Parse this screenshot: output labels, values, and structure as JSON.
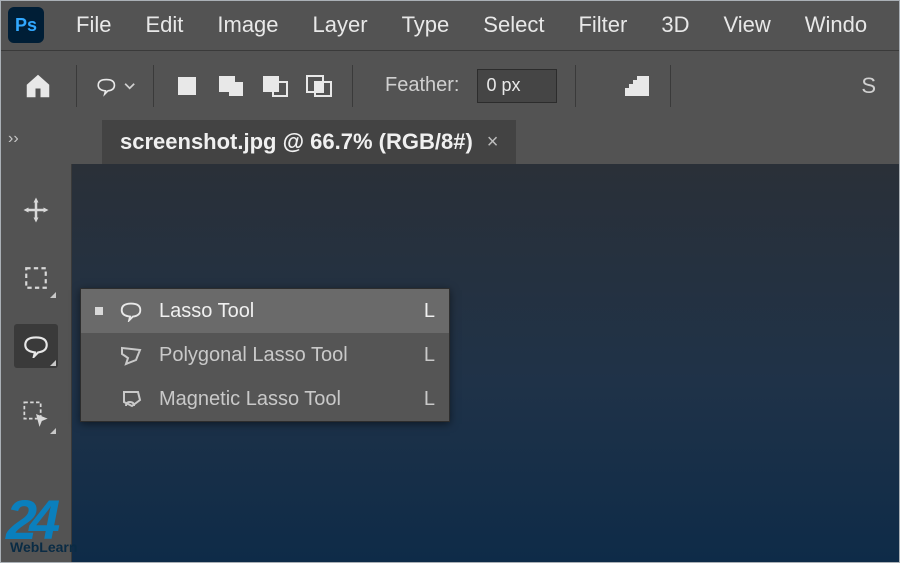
{
  "app": {
    "logo": "Ps"
  },
  "menu": [
    "File",
    "Edit",
    "Image",
    "Layer",
    "Type",
    "Select",
    "Filter",
    "3D",
    "View",
    "Windo"
  ],
  "options": {
    "feather_label": "Feather:",
    "feather_value": "0 px",
    "right_char": "S"
  },
  "tab": {
    "title": "screenshot.jpg @ 66.7% (RGB/8#)",
    "close": "×"
  },
  "flyout": {
    "items": [
      {
        "label": "Lasso Tool",
        "shortcut": "L",
        "selected": true,
        "icon": "lasso"
      },
      {
        "label": "Polygonal Lasso Tool",
        "shortcut": "L",
        "selected": false,
        "icon": "poly-lasso"
      },
      {
        "label": "Magnetic Lasso Tool",
        "shortcut": "L",
        "selected": false,
        "icon": "mag-lasso"
      }
    ]
  },
  "watermark": {
    "num": "24",
    "text": "WebLearn"
  }
}
